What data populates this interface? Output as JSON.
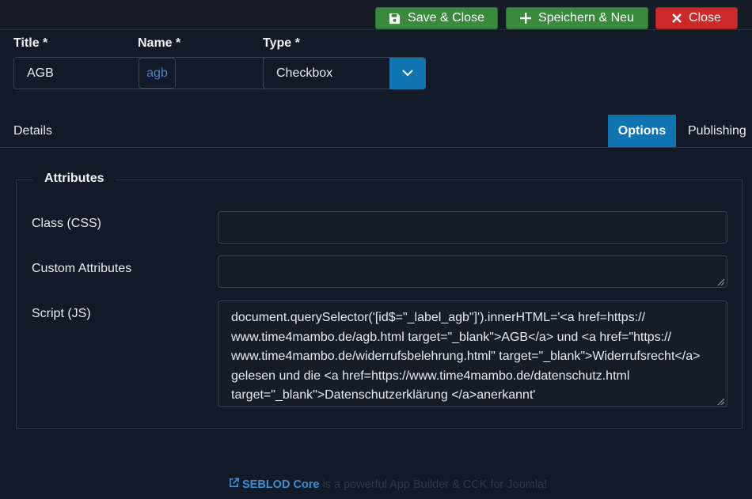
{
  "toolbar": {
    "save_close": "Save & Close",
    "save_new": "Speichern & Neu",
    "close": "Close"
  },
  "form": {
    "title_label": "Title *",
    "title_value": "AGB",
    "name_label": "Name *",
    "name_value": "agb",
    "type_label": "Type *",
    "type_value": "Checkbox"
  },
  "tabs": {
    "details": "Details",
    "options": "Options",
    "publishing": "Publishing"
  },
  "attributes": {
    "legend": "Attributes",
    "class_label": "Class (CSS)",
    "class_value": "",
    "custom_label": "Custom Attributes",
    "custom_value": "",
    "script_label": "Script (JS)",
    "script_value": "document.querySelector('[id$=\"_label_agb\"]').innerHTML='<a href=https://\nwww.time4mambo.de/agb.html target=\"_blank\">AGB</a> und <a href=\"https://\nwww.time4mambo.de/widerrufsbelehrung.html\" target=\"_blank\">Widerrufsrecht</a>\ngelesen und die <a href=https://www.time4mambo.de/datenschutz.html\ntarget=\"_blank\">Datenschutzerklärung </a>anerkannt'"
  },
  "footer": {
    "brand": "SEBLOD Core",
    "text": "is a powerful App Builder & CCK for Joomla!"
  },
  "colors": {
    "background": "#111a26",
    "accent": "#0f74b0",
    "green": "#3a8a3e",
    "red": "#cc2a2a",
    "link": "#3b8fd6"
  }
}
